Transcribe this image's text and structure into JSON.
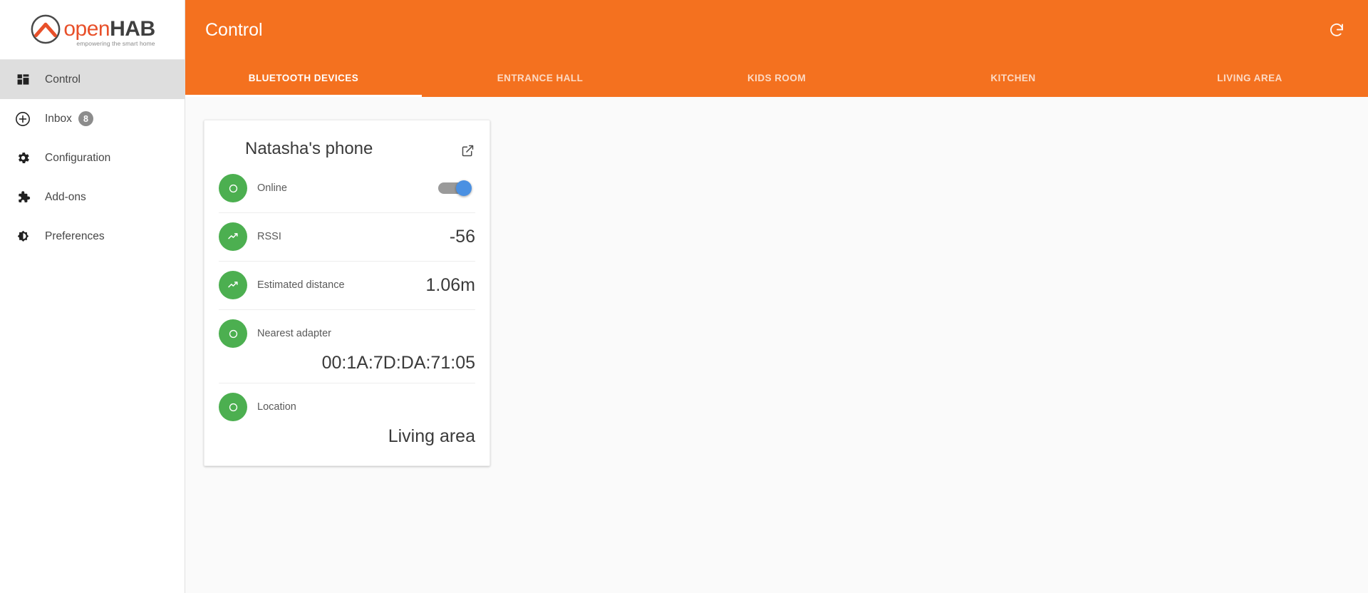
{
  "brand": {
    "logo_open": "open",
    "logo_hab": "HAB",
    "tagline": "empowering the smart home",
    "logo_icon": "openhab-logo-icon",
    "accent_orange": "#f4711f",
    "logo_orange": "#e8502a",
    "green": "#4caf50",
    "toggle_blue": "#4a90e2"
  },
  "sidebar": {
    "items": [
      {
        "label": "Control",
        "icon": "dashboard-grid-icon",
        "active": true,
        "badge": null
      },
      {
        "label": "Inbox",
        "icon": "plus-circle-icon",
        "active": false,
        "badge": "8"
      },
      {
        "label": "Configuration",
        "icon": "gear-icon",
        "active": false,
        "badge": null
      },
      {
        "label": "Add-ons",
        "icon": "puzzle-piece-icon",
        "active": false,
        "badge": null
      },
      {
        "label": "Preferences",
        "icon": "brightness-icon",
        "active": false,
        "badge": null
      }
    ]
  },
  "header": {
    "title": "Control",
    "refresh_icon": "refresh-icon"
  },
  "tabs": [
    {
      "label": "Bluetooth devices",
      "active": true
    },
    {
      "label": "Entrance hall",
      "active": false
    },
    {
      "label": "Kids room",
      "active": false
    },
    {
      "label": "Kitchen",
      "active": false
    },
    {
      "label": "Living area",
      "active": false
    }
  ],
  "card": {
    "title": "Natasha's phone",
    "external_link_icon": "external-link-icon",
    "rows": [
      {
        "label": "Online",
        "icon": "circle-outline-icon",
        "type": "toggle",
        "toggle_on": true,
        "value": "",
        "wrap": false
      },
      {
        "label": "RSSI",
        "icon": "trend-line-icon",
        "type": "value",
        "value": "-56",
        "wrap": false
      },
      {
        "label": "Estimated distance",
        "icon": "trend-line-icon",
        "type": "value",
        "value": "1.06m",
        "wrap": false
      },
      {
        "label": "Nearest adapter",
        "icon": "circle-outline-icon",
        "type": "value",
        "value": "00:1A:7D:DA:71:05",
        "wrap": true
      },
      {
        "label": "Location",
        "icon": "circle-outline-icon",
        "type": "value",
        "value": "Living area",
        "wrap": true
      }
    ]
  }
}
